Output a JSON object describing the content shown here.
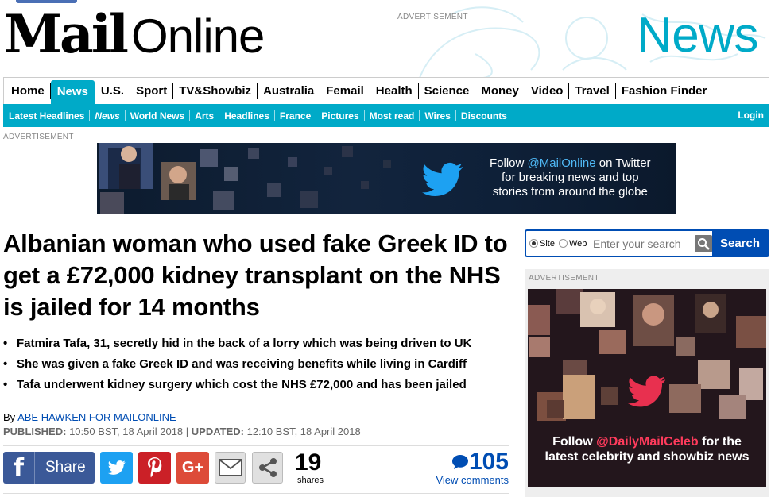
{
  "masthead": {
    "logo_mail": "Mail",
    "logo_online": "Online",
    "ad_label": "ADVERTISEMENT",
    "section": "News"
  },
  "nav": {
    "primary": [
      "Home",
      "News",
      "U.S.",
      "Sport",
      "TV&Showbiz",
      "Australia",
      "Femail",
      "Health",
      "Science",
      "Money",
      "Video",
      "Travel",
      "Fashion Finder"
    ],
    "active": "News",
    "secondary": [
      "Latest Headlines",
      "News",
      "World News",
      "Arts",
      "Headlines",
      "France",
      "Pictures",
      "Most read",
      "Wires",
      "Discounts"
    ],
    "login": "Login"
  },
  "ads": {
    "label": "ADVERTISEMENT",
    "banner_line1_pre": "Follow ",
    "banner_handle": "@MailOnline",
    "banner_line1_post": " on Twitter",
    "banner_line2": "for breaking news and top",
    "banner_line3": "stories from around the globe",
    "celeb_pre": "Follow ",
    "celeb_handle": "@DailyMailCeleb",
    "celeb_post": " for the",
    "celeb_line2": "latest celebrity and showbiz news"
  },
  "article": {
    "headline": "Albanian woman who used fake Greek ID to get a £72,000 kidney transplant on the NHS is jailed for 14 months",
    "bullets": [
      "Fatmira Tafa, 31, secretly hid in the back of a lorry which was being driven to UK",
      "She was given a fake Greek ID and was receiving benefits while living in Cardiff",
      "Tafa underwent kidney surgery which cost the NHS £72,000 and has been jailed"
    ],
    "by": "By ",
    "author": "ABE HAWKEN FOR MAILONLINE",
    "published_label": "PUBLISHED:",
    "published": " 10:50 BST, 18 April 2018 | ",
    "updated_label": "UPDATED:",
    "updated": " 12:10 BST, 18 April 2018"
  },
  "share": {
    "facebook_label": "Share",
    "count": "19",
    "count_label": "shares",
    "comments": "105",
    "view_comments": "View comments"
  },
  "search": {
    "site_label": "Site",
    "web_label": "Web",
    "placeholder": "Enter your search",
    "button": "Search"
  }
}
